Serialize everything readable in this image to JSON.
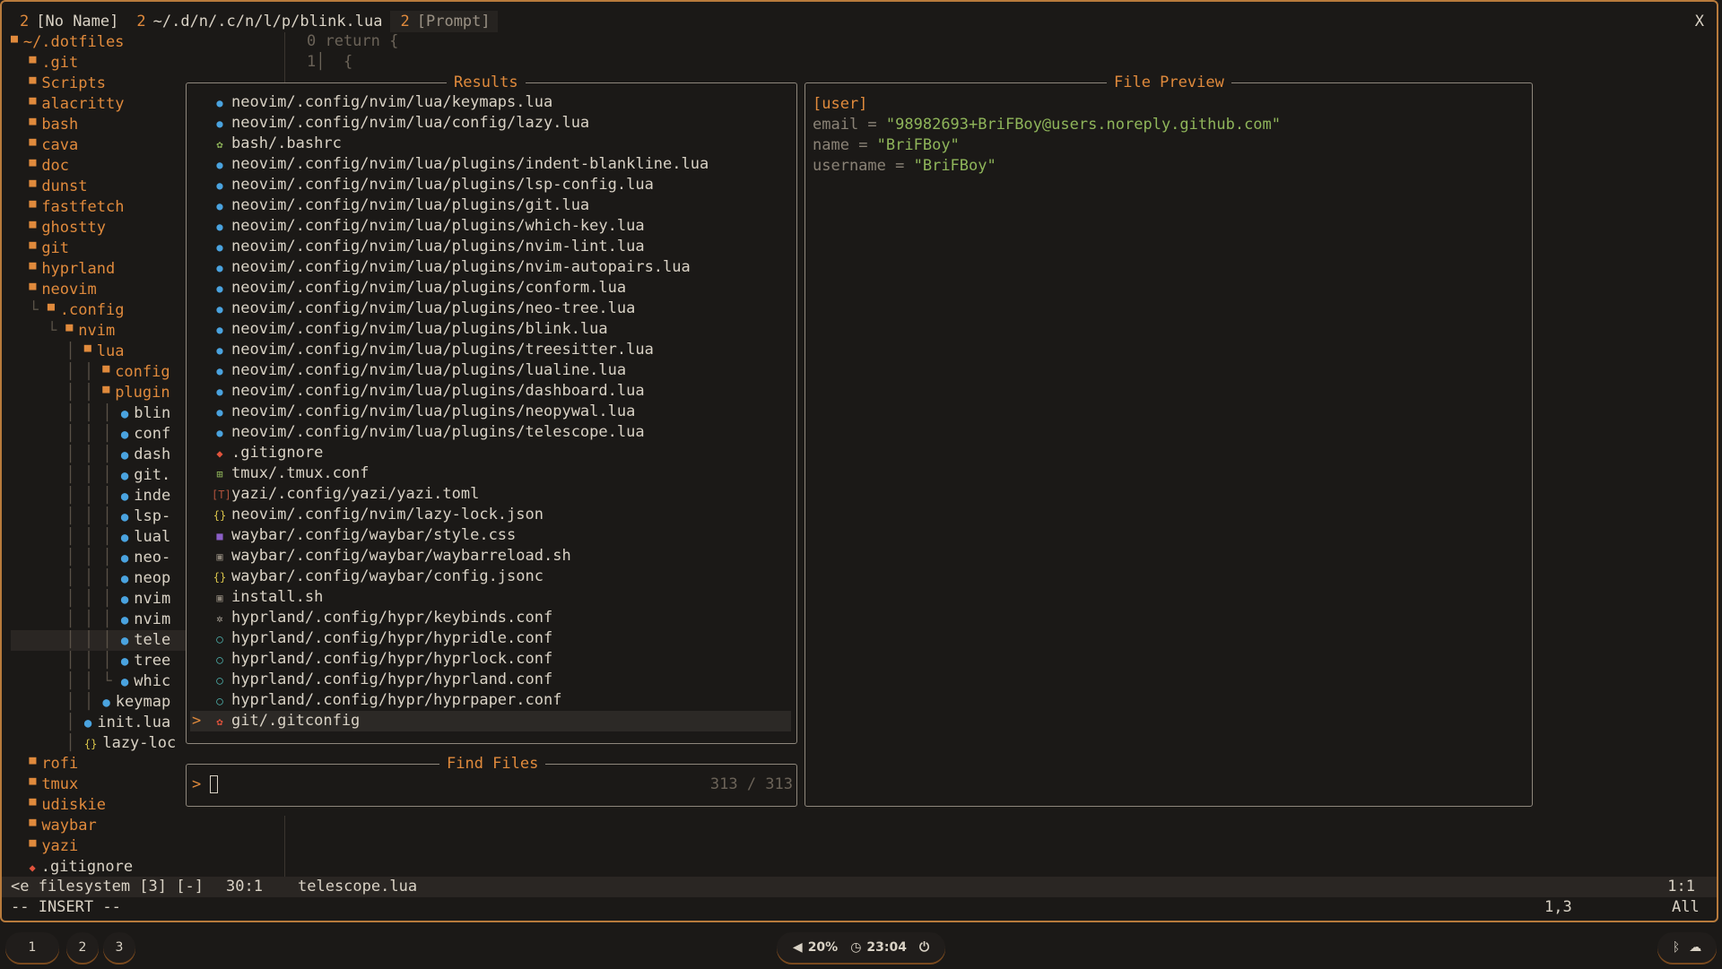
{
  "tabline": {
    "tabs": [
      {
        "num": "2",
        "label": "[No Name]"
      },
      {
        "num": "2",
        "label": "~/.d/n/.c/n/l/p/blink.lua"
      },
      {
        "num": "2",
        "label": "[Prompt]"
      }
    ],
    "close": "X"
  },
  "tree": {
    "root": "~/.dotfiles",
    "rows": [
      {
        "label": ".git",
        "type": "dir",
        "prefix": ""
      },
      {
        "label": "Scripts",
        "type": "dir",
        "prefix": ""
      },
      {
        "label": "alacritty",
        "type": "dir",
        "prefix": ""
      },
      {
        "label": "bash",
        "type": "dir",
        "prefix": ""
      },
      {
        "label": "cava",
        "type": "dir",
        "prefix": ""
      },
      {
        "label": "doc",
        "type": "dir",
        "prefix": ""
      },
      {
        "label": "dunst",
        "type": "dir",
        "prefix": ""
      },
      {
        "label": "fastfetch",
        "type": "dir",
        "prefix": ""
      },
      {
        "label": "ghostty",
        "type": "dir",
        "prefix": ""
      },
      {
        "label": "git",
        "type": "dir",
        "prefix": ""
      },
      {
        "label": "hyprland",
        "type": "dir",
        "prefix": ""
      },
      {
        "label": "neovim",
        "type": "dir",
        "prefix": ""
      },
      {
        "label": ".config",
        "type": "dir",
        "prefix": "└ "
      },
      {
        "label": "nvim",
        "type": "dir",
        "prefix": "  └ "
      },
      {
        "label": "lua",
        "type": "dir",
        "prefix": "    │ "
      },
      {
        "label": "config",
        "type": "dir",
        "prefix": "    │ │ "
      },
      {
        "label": "plugin",
        "type": "dir",
        "prefix": "    │ │ "
      },
      {
        "label": "blin",
        "type": "lua",
        "prefix": "    │ │ │ "
      },
      {
        "label": "conf",
        "type": "lua",
        "prefix": "    │ │ │ "
      },
      {
        "label": "dash",
        "type": "lua",
        "prefix": "    │ │ │ "
      },
      {
        "label": "git.",
        "type": "lua",
        "prefix": "    │ │ │ "
      },
      {
        "label": "inde",
        "type": "lua",
        "prefix": "    │ │ │ "
      },
      {
        "label": "lsp-",
        "type": "lua",
        "prefix": "    │ │ │ "
      },
      {
        "label": "lual",
        "type": "lua",
        "prefix": "    │ │ │ "
      },
      {
        "label": "neo-",
        "type": "lua",
        "prefix": "    │ │ │ "
      },
      {
        "label": "neop",
        "type": "lua",
        "prefix": "    │ │ │ "
      },
      {
        "label": "nvim",
        "type": "lua",
        "prefix": "    │ │ │ "
      },
      {
        "label": "nvim",
        "type": "lua",
        "prefix": "    │ │ │ "
      },
      {
        "label": "tele",
        "type": "lua",
        "prefix": "    │ │ │ "
      },
      {
        "label": "tree",
        "type": "lua",
        "prefix": "    │ │ │ "
      },
      {
        "label": "whic",
        "type": "lua",
        "prefix": "    │ │ └ "
      },
      {
        "label": "keymap",
        "type": "lua",
        "prefix": "    │ │ "
      },
      {
        "label": "init.lua",
        "type": "lua",
        "prefix": "    │ "
      },
      {
        "label": "lazy-loc",
        "type": "json",
        "prefix": "    │ "
      },
      {
        "label": "rofi",
        "type": "dir",
        "prefix": ""
      },
      {
        "label": "tmux",
        "type": "dir",
        "prefix": ""
      },
      {
        "label": "udiskie",
        "type": "dir",
        "prefix": ""
      },
      {
        "label": "waybar",
        "type": "dir",
        "prefix": ""
      },
      {
        "label": "yazi",
        "type": "dir",
        "prefix": ""
      },
      {
        "label": ".gitignore",
        "type": "git",
        "prefix": ""
      }
    ]
  },
  "editor": {
    "line0": "0 return {",
    "line1": "1│  {"
  },
  "results": {
    "title": "Results",
    "items": [
      {
        "icon": "lua",
        "path": "neovim/.config/nvim/lua/keymaps.lua"
      },
      {
        "icon": "lua",
        "path": "neovim/.config/nvim/lua/config/lazy.lua"
      },
      {
        "icon": "gear",
        "path": "bash/.bashrc"
      },
      {
        "icon": "lua",
        "path": "neovim/.config/nvim/lua/plugins/indent-blankline.lua"
      },
      {
        "icon": "lua",
        "path": "neovim/.config/nvim/lua/plugins/lsp-config.lua"
      },
      {
        "icon": "lua",
        "path": "neovim/.config/nvim/lua/plugins/git.lua"
      },
      {
        "icon": "lua",
        "path": "neovim/.config/nvim/lua/plugins/which-key.lua"
      },
      {
        "icon": "lua",
        "path": "neovim/.config/nvim/lua/plugins/nvim-lint.lua"
      },
      {
        "icon": "lua",
        "path": "neovim/.config/nvim/lua/plugins/nvim-autopairs.lua"
      },
      {
        "icon": "lua",
        "path": "neovim/.config/nvim/lua/plugins/conform.lua"
      },
      {
        "icon": "lua",
        "path": "neovim/.config/nvim/lua/plugins/neo-tree.lua"
      },
      {
        "icon": "lua",
        "path": "neovim/.config/nvim/lua/plugins/blink.lua"
      },
      {
        "icon": "lua",
        "path": "neovim/.config/nvim/lua/plugins/treesitter.lua"
      },
      {
        "icon": "lua",
        "path": "neovim/.config/nvim/lua/plugins/lualine.lua"
      },
      {
        "icon": "lua",
        "path": "neovim/.config/nvim/lua/plugins/dashboard.lua"
      },
      {
        "icon": "lua",
        "path": "neovim/.config/nvim/lua/plugins/neopywal.lua"
      },
      {
        "icon": "lua",
        "path": "neovim/.config/nvim/lua/plugins/telescope.lua"
      },
      {
        "icon": "git",
        "path": ".gitignore"
      },
      {
        "icon": "tmux",
        "path": "tmux/.tmux.conf"
      },
      {
        "icon": "toml",
        "path": "yazi/.config/yazi/yazi.toml"
      },
      {
        "icon": "json",
        "path": "neovim/.config/nvim/lazy-lock.json"
      },
      {
        "icon": "css",
        "path": "waybar/.config/waybar/style.css"
      },
      {
        "icon": "sh",
        "path": "waybar/.config/waybar/waybarreload.sh"
      },
      {
        "icon": "json",
        "path": "waybar/.config/waybar/config.jsonc"
      },
      {
        "icon": "sh",
        "path": "install.sh"
      },
      {
        "icon": "cog",
        "path": "hyprland/.config/hypr/keybinds.conf"
      },
      {
        "icon": "hypr",
        "path": "hyprland/.config/hypr/hypridle.conf"
      },
      {
        "icon": "hypr",
        "path": "hyprland/.config/hypr/hyprlock.conf"
      },
      {
        "icon": "hypr",
        "path": "hyprland/.config/hypr/hyprland.conf"
      },
      {
        "icon": "hypr",
        "path": "hyprland/.config/hypr/hyprpaper.conf"
      },
      {
        "icon": "gitcfg",
        "path": "git/.gitconfig"
      }
    ],
    "selected_caret": ">"
  },
  "find": {
    "title": "Find Files",
    "prompt": ">",
    "count": "313 / 313"
  },
  "preview": {
    "title": "File Preview",
    "section": "[user]",
    "entries": [
      {
        "key": "email",
        "eq": " = ",
        "value": "\"98982693+BriFBoy@users.noreply.github.com\""
      },
      {
        "key": "name",
        "eq": " = ",
        "value": "\"BriFBoy\""
      },
      {
        "key": "username",
        "eq": " = ",
        "value": "\"BriFBoy\""
      }
    ]
  },
  "statusline": {
    "left": "<e filesystem [3] [-]",
    "pos": "30:1",
    "file": "telescope.lua",
    "right": "1:1"
  },
  "modeline": {
    "mode": "-- INSERT --",
    "pos": "1,3",
    "scroll": "All"
  },
  "bar": {
    "workspaces": [
      "1",
      "2",
      "3"
    ],
    "volume": "20%",
    "time": "23:04",
    "icons": {
      "volume": "speaker-icon",
      "clock": "clock-icon",
      "power": "power-icon",
      "bluetooth": "bluetooth-icon",
      "tray": "tray-icon"
    }
  },
  "colors": {
    "accent": "#e08a3c",
    "border": "#b87b3c",
    "string": "#8fb55a",
    "lua": "#4aa3df",
    "git": "#e0533c"
  }
}
